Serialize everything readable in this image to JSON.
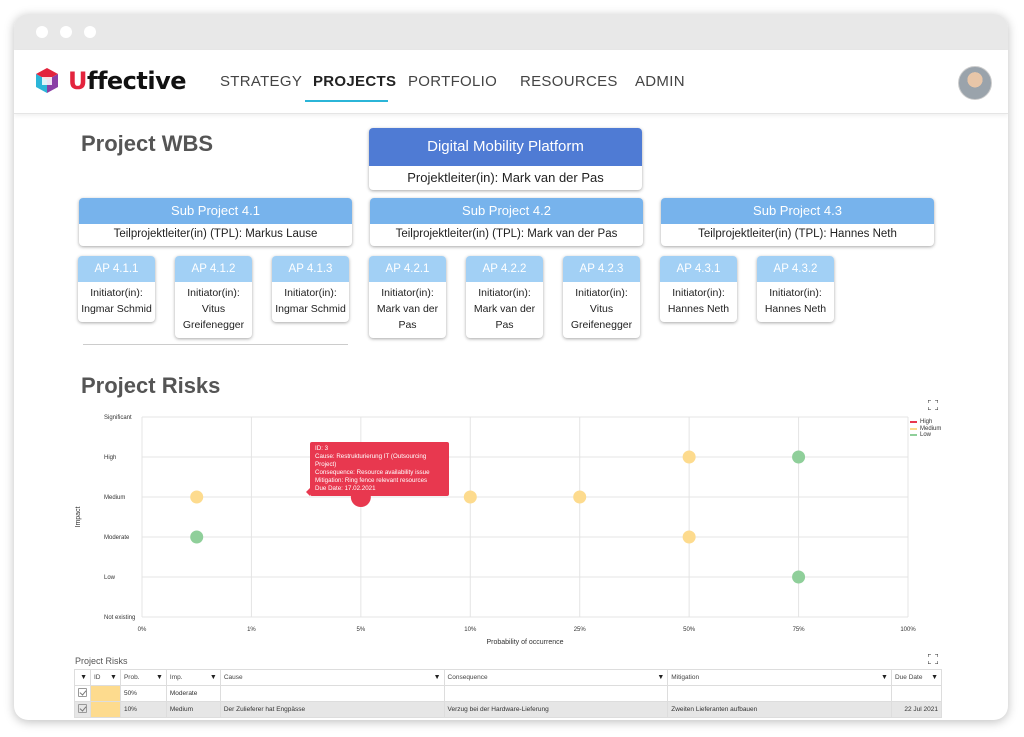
{
  "app": {
    "brand_first": "U",
    "brand_rest": "ffective"
  },
  "nav": {
    "items": [
      {
        "label": "STRATEGY"
      },
      {
        "label": "PROJECTS"
      },
      {
        "label": "PORTFOLIO"
      },
      {
        "label": "RESOURCES"
      },
      {
        "label": "ADMIN"
      }
    ],
    "active": "PROJECTS"
  },
  "wbs": {
    "title": "Project WBS",
    "root": {
      "title": "Digital Mobility Platform",
      "lead": "Projektleiter(in): Mark van der Pas"
    },
    "subprojects": [
      {
        "title": "Sub Project 4.1",
        "lead": "Teilprojektleiter(in) (TPL): Markus Lause"
      },
      {
        "title": "Sub Project 4.2",
        "lead": "Teilprojektleiter(in) (TPL): Mark van der Pas"
      },
      {
        "title": "Sub Project 4.3",
        "lead": "Teilprojektleiter(in) (TPL): Hannes Neth"
      }
    ],
    "work_packages": [
      {
        "title": "AP 4.1.1",
        "l1": "Initiator(in):",
        "l2": "Ingmar Schmid",
        "l3": ""
      },
      {
        "title": "AP 4.1.2",
        "l1": "Initiator(in):",
        "l2": "Vitus",
        "l3": "Greifenegger"
      },
      {
        "title": "AP 4.1.3",
        "l1": "Initiator(in):",
        "l2": "Ingmar Schmid",
        "l3": ""
      },
      {
        "title": "AP 4.2.1",
        "l1": "Initiator(in):",
        "l2": "Mark van der",
        "l3": "Pas"
      },
      {
        "title": "AP 4.2.2",
        "l1": "Initiator(in):",
        "l2": "Mark van der",
        "l3": "Pas"
      },
      {
        "title": "AP 4.2.3",
        "l1": "Initiator(in):",
        "l2": "Vitus",
        "l3": "Greifenegger"
      },
      {
        "title": "AP 4.3.1",
        "l1": "Initiator(in):",
        "l2": "Hannes Neth",
        "l3": ""
      },
      {
        "title": "AP 4.3.2",
        "l1": "Initiator(in):",
        "l2": "Hannes Neth",
        "l3": ""
      }
    ]
  },
  "risks": {
    "title": "Project Risks",
    "tooltip": {
      "l1": "ID: 3",
      "l2": "Cause: Restrukturierung IT (Outsourcing Project)",
      "l3": "Consequence: Resource availability issue",
      "l4": "Mitigation: Ring fence relevant resources",
      "l5": "Due Date: 17.02.2021"
    },
    "table_title": "Project Risks",
    "table": {
      "headers": {
        "id": "ID",
        "prob": "Prob.",
        "imp": "Imp.",
        "cause": "Cause",
        "consequence": "Consequence",
        "mitigation": "Mitigation",
        "due": "Due Date"
      },
      "rows": [
        {
          "prob": "50%",
          "imp": "Moderate",
          "cause": "",
          "consequence": "",
          "mitigation": "",
          "due": ""
        },
        {
          "prob": "10%",
          "imp": "Medium",
          "cause": "Der Zulieferer hat Engpässe",
          "consequence": "Verzug bei der Hardware-Lieferung",
          "mitigation": "Zweiten Lieferanten aufbauen",
          "due": "22 Jul 2021"
        }
      ]
    }
  },
  "colors": {
    "high": "#e8384f",
    "medium": "#fddb8e",
    "low": "#8fcf9a",
    "accent": "#2bb5d8"
  },
  "chart_data": {
    "type": "scatter",
    "xlabel": "Probability of occurrence",
    "ylabel": "Impact",
    "x_ticks": [
      "0%",
      "1%",
      "5%",
      "10%",
      "25%",
      "50%",
      "75%",
      "100%"
    ],
    "y_ticks": [
      "Not existing",
      "Low",
      "Moderate",
      "Medium",
      "High",
      "Significant"
    ],
    "legend": [
      "High",
      "Medium",
      "Low"
    ],
    "legend_position": "top-right",
    "grid": true,
    "points": [
      {
        "x": "0.5%",
        "y": "Medium",
        "level": "Medium"
      },
      {
        "x": "5%",
        "y": "Medium",
        "level": "High"
      },
      {
        "x": "10%",
        "y": "Medium",
        "level": "Medium"
      },
      {
        "x": "25%",
        "y": "Medium",
        "level": "Medium"
      },
      {
        "x": "50%",
        "y": "High",
        "level": "Medium"
      },
      {
        "x": "75%",
        "y": "High",
        "level": "Low"
      },
      {
        "x": "0.5%",
        "y": "Moderate",
        "level": "Low"
      },
      {
        "x": "50%",
        "y": "Moderate",
        "level": "Medium"
      },
      {
        "x": "75%",
        "y": "Low",
        "level": "Low"
      }
    ]
  }
}
